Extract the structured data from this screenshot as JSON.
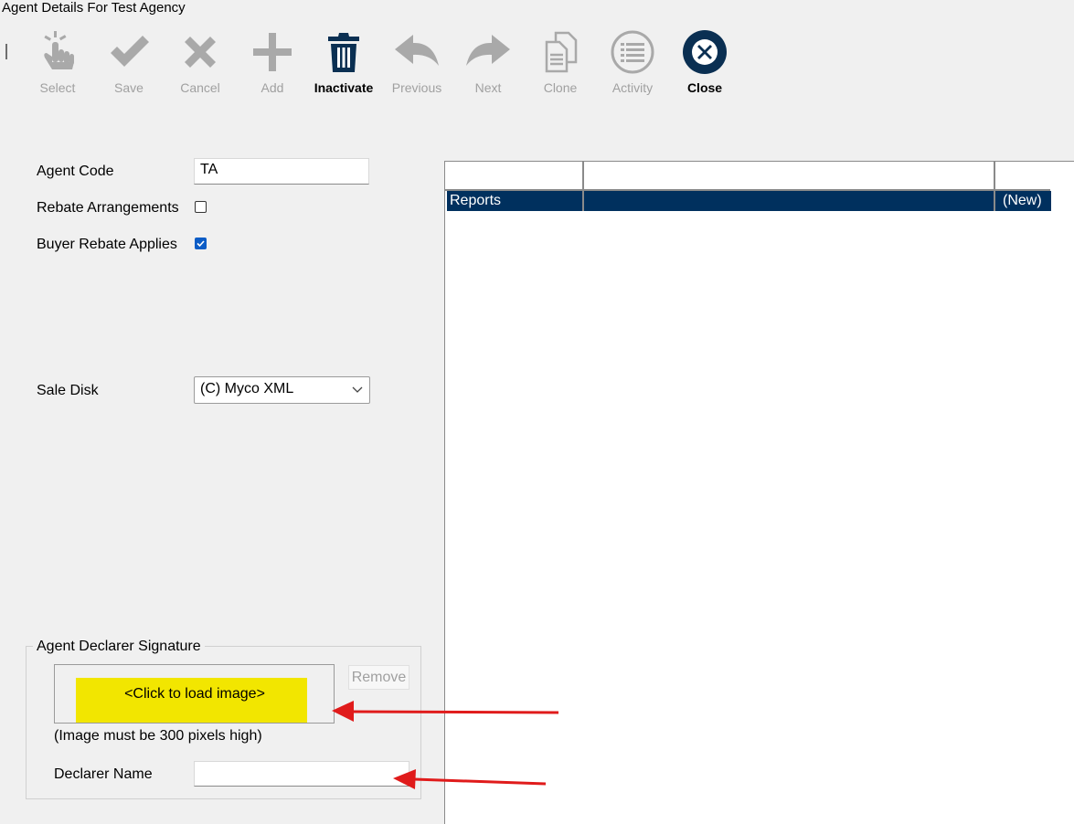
{
  "window": {
    "title": "Agent Details For Test Agency"
  },
  "toolbar": {
    "buttons": [
      {
        "label": "Select",
        "icon": "hand-pointer-icon",
        "enabled": false
      },
      {
        "label": "Save",
        "icon": "check-icon",
        "enabled": false
      },
      {
        "label": "Cancel",
        "icon": "x-icon",
        "enabled": false
      },
      {
        "label": "Add",
        "icon": "plus-icon",
        "enabled": false
      },
      {
        "label": "Inactivate",
        "icon": "trash-icon",
        "enabled": true
      },
      {
        "label": "Previous",
        "icon": "arrow-back-icon",
        "enabled": false
      },
      {
        "label": "Next",
        "icon": "arrow-forward-icon",
        "enabled": false
      },
      {
        "label": "Clone",
        "icon": "clone-icon",
        "enabled": false
      },
      {
        "label": "Activity",
        "icon": "list-circle-icon",
        "enabled": false
      },
      {
        "label": "Close",
        "icon": "close-circle-icon",
        "enabled": true
      }
    ]
  },
  "form": {
    "agent_code_label": "Agent Code",
    "agent_code_value": "TA",
    "rebate_arrangements_label": "Rebate Arrangements",
    "rebate_arrangements_checked": false,
    "buyer_rebate_label": "Buyer Rebate Applies",
    "buyer_rebate_checked": true,
    "sale_disk_label": "Sale Disk",
    "sale_disk_value": "(C) Myco XML"
  },
  "signature": {
    "group_title": "Agent Declarer Signature",
    "image_placeholder": "<Click to load image>",
    "remove_label": "Remove",
    "hint": "(Image must be 300 pixels high)",
    "declarer_name_label": "Declarer Name",
    "declarer_name_value": ""
  },
  "grid": {
    "rows": [
      {
        "name": "Reports",
        "detail": "",
        "status": "(New)"
      }
    ]
  },
  "colors": {
    "selection": "#00305e",
    "accent_icon": "#0a2f52",
    "disabled": "#a0a0a0",
    "highlight": "#f2e600",
    "annotation_arrow": "#e01b1b"
  }
}
